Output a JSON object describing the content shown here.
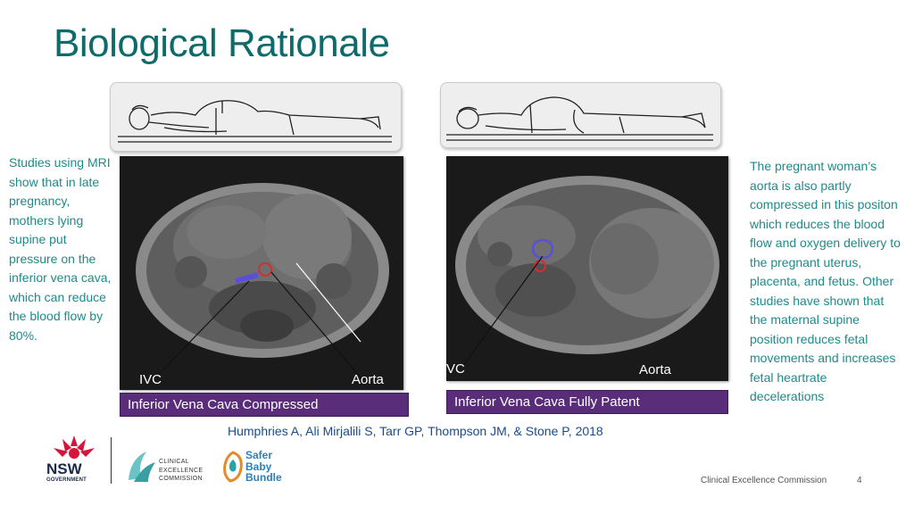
{
  "slide": {
    "title": "Biological Rationale",
    "left_text": "Studies using MRI show that in late pregnancy, mothers lying supine put pressure on the inferior vena cava, which can reduce the blood flow by 80%.",
    "right_text": "The pregnant woman’s aorta is also partly compressed in this positon which reduces the blood flow and oxygen delivery to the pregnant uterus, placenta, and fetus. Other studies have shown that the maternal supine position reduces fetal movements and increases fetal heartrate decelerations",
    "citation": "Humphries A, Ali Mirjalili S, Tarr GP, Thompson JM, & Stone P, 2018"
  },
  "images": {
    "left": {
      "ivc_label": "IVC",
      "aorta_label": "Aorta",
      "caption": "Inferior Vena Cava Compressed"
    },
    "right": {
      "ivc_label": "VC",
      "aorta_label": "Aorta",
      "caption": "Inferior Vena Cava Fully Patent"
    }
  },
  "footer": {
    "organisation": "Clinical Excellence Commission",
    "page_number": "4",
    "nsw_logo_text": "NSW",
    "nsw_gov_text": "GOVERNMENT",
    "cec_logo_text": "CLINICAL EXCELLENCE COMMISSION",
    "sbb_logo_text": "Safer Baby Bundle"
  },
  "colors": {
    "title": "#0f6b6a",
    "body_text": "#1f8a8a",
    "caption_bg": "#5a2d7a",
    "citation": "#1a4c8a"
  }
}
